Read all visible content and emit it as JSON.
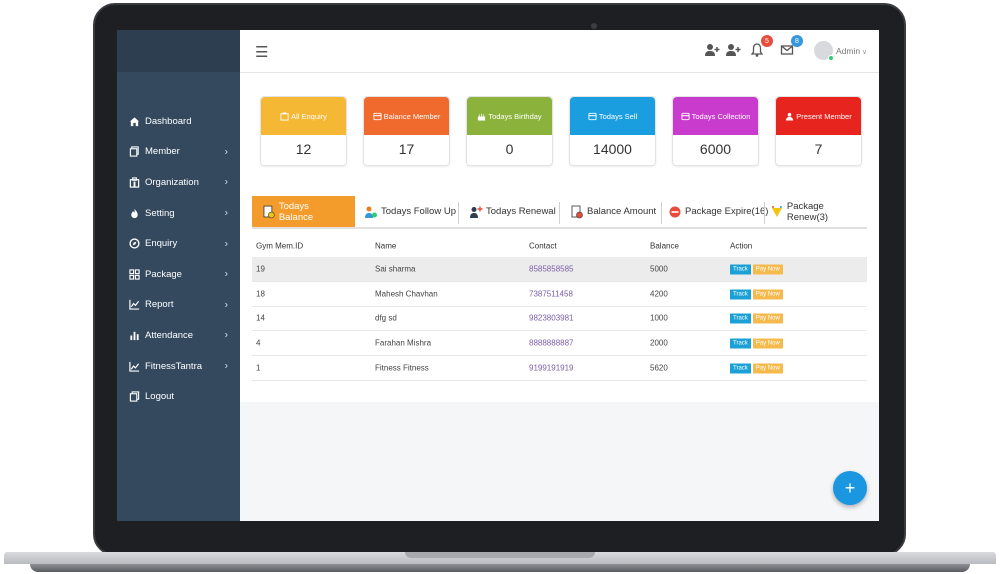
{
  "sidebar": {
    "items": [
      {
        "label": "Dashboard",
        "icon": "home-icon",
        "chevron": false
      },
      {
        "label": "Member",
        "icon": "member-icon",
        "chevron": true
      },
      {
        "label": "Organization",
        "icon": "organization-icon",
        "chevron": true
      },
      {
        "label": "Setting",
        "icon": "setting-icon",
        "chevron": true
      },
      {
        "label": "Enquiry",
        "icon": "enquiry-icon",
        "chevron": true
      },
      {
        "label": "Package",
        "icon": "package-icon",
        "chevron": true
      },
      {
        "label": "Report",
        "icon": "report-icon",
        "chevron": true
      },
      {
        "label": "Attendance",
        "icon": "attendance-icon",
        "chevron": true
      },
      {
        "label": "FitnessTantra",
        "icon": "fitnesstantra-icon",
        "chevron": true
      },
      {
        "label": "Logout",
        "icon": "logout-icon",
        "chevron": false
      }
    ]
  },
  "topbar": {
    "notifications_count": "5",
    "messages_count": "8",
    "user_name": "Admin",
    "colors": {
      "notifications_badge": "#e74c3c",
      "messages_badge": "#3498db"
    }
  },
  "cards": [
    {
      "label": "All Enquiry",
      "value": "12",
      "color": "#f5b835"
    },
    {
      "label": "Balance Member",
      "value": "17",
      "color": "#ef6a2c"
    },
    {
      "label": "Todays Birthday",
      "value": "0",
      "color": "#8bb23a"
    },
    {
      "label": "Todays Sell",
      "value": "14000",
      "color": "#1a9ee0"
    },
    {
      "label": "Todays Collection",
      "value": "6000",
      "color": "#c93bcc"
    },
    {
      "label": "Present Member",
      "value": "7",
      "color": "#e8241f"
    }
  ],
  "tabs": [
    {
      "label": "Todays Balance",
      "active": true
    },
    {
      "label": "Todays Follow Up",
      "active": false
    },
    {
      "label": "Todays Renewal",
      "active": false
    },
    {
      "label": "Balance Amount",
      "active": false
    },
    {
      "label": "Package Expire(16)",
      "active": false
    },
    {
      "label": "Package Renew(3)",
      "active": false
    }
  ],
  "table": {
    "headers": [
      "Gym Mem.ID",
      "Name",
      "Contact",
      "Balance",
      "Action"
    ],
    "rows": [
      {
        "id": "19",
        "name": "Sai sharma",
        "contact": "8585858585",
        "balance": "5000"
      },
      {
        "id": "18",
        "name": "Mahesh Chavhan",
        "contact": "7387511458",
        "balance": "4200"
      },
      {
        "id": "14",
        "name": "dfg sd",
        "contact": "9823803981",
        "balance": "1000"
      },
      {
        "id": "4",
        "name": "Farahan Mishra",
        "contact": "8888888887",
        "balance": "2000"
      },
      {
        "id": "1",
        "name": "Fitness Fitness",
        "contact": "9199191919",
        "balance": "5620"
      }
    ],
    "track_label": "Track",
    "pay_label": "Pay Now"
  },
  "fab": {
    "label": "+"
  }
}
